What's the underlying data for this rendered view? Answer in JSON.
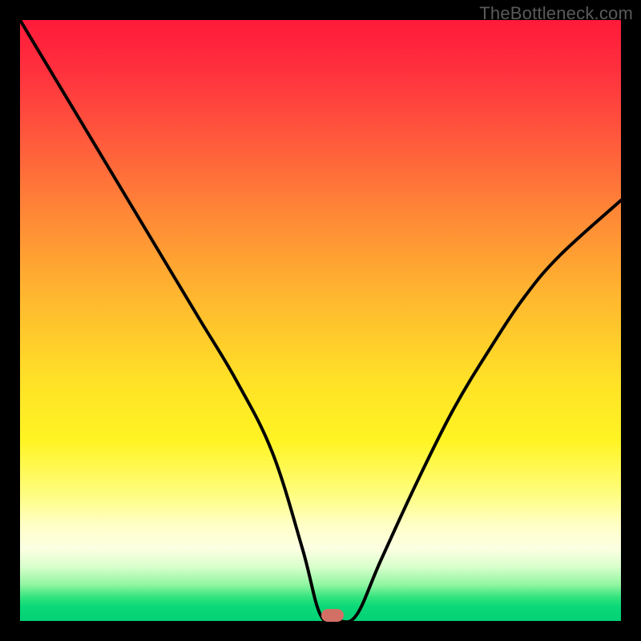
{
  "watermark": "TheBottleneck.com",
  "chart_data": {
    "type": "line",
    "title": "",
    "xlabel": "",
    "ylabel": "",
    "xlim": [
      0,
      100
    ],
    "ylim": [
      0,
      100
    ],
    "grid": false,
    "legend": false,
    "series": [
      {
        "name": "bottleneck-curve",
        "x": [
          0,
          6,
          12,
          18,
          24,
          30,
          36,
          42,
          47,
          50,
          53,
          56,
          60,
          66,
          72,
          78,
          84,
          90,
          100
        ],
        "values": [
          100,
          90,
          80,
          70,
          60,
          50,
          40,
          28,
          12,
          1,
          0,
          1,
          10,
          23,
          35,
          45,
          54,
          61,
          70
        ]
      }
    ],
    "marker": {
      "x": 52,
      "y": 1
    },
    "background_gradient": {
      "stops": [
        {
          "pos": 0.0,
          "color": "#ff1a3a"
        },
        {
          "pos": 0.2,
          "color": "#ff5a3c"
        },
        {
          "pos": 0.46,
          "color": "#ffb72f"
        },
        {
          "pos": 0.7,
          "color": "#fff423"
        },
        {
          "pos": 0.88,
          "color": "#fcffe2"
        },
        {
          "pos": 1.0,
          "color": "#02d175"
        }
      ]
    }
  },
  "colors": {
    "curve_stroke": "#000000",
    "marker_fill": "#d27066",
    "frame": "#000000"
  }
}
